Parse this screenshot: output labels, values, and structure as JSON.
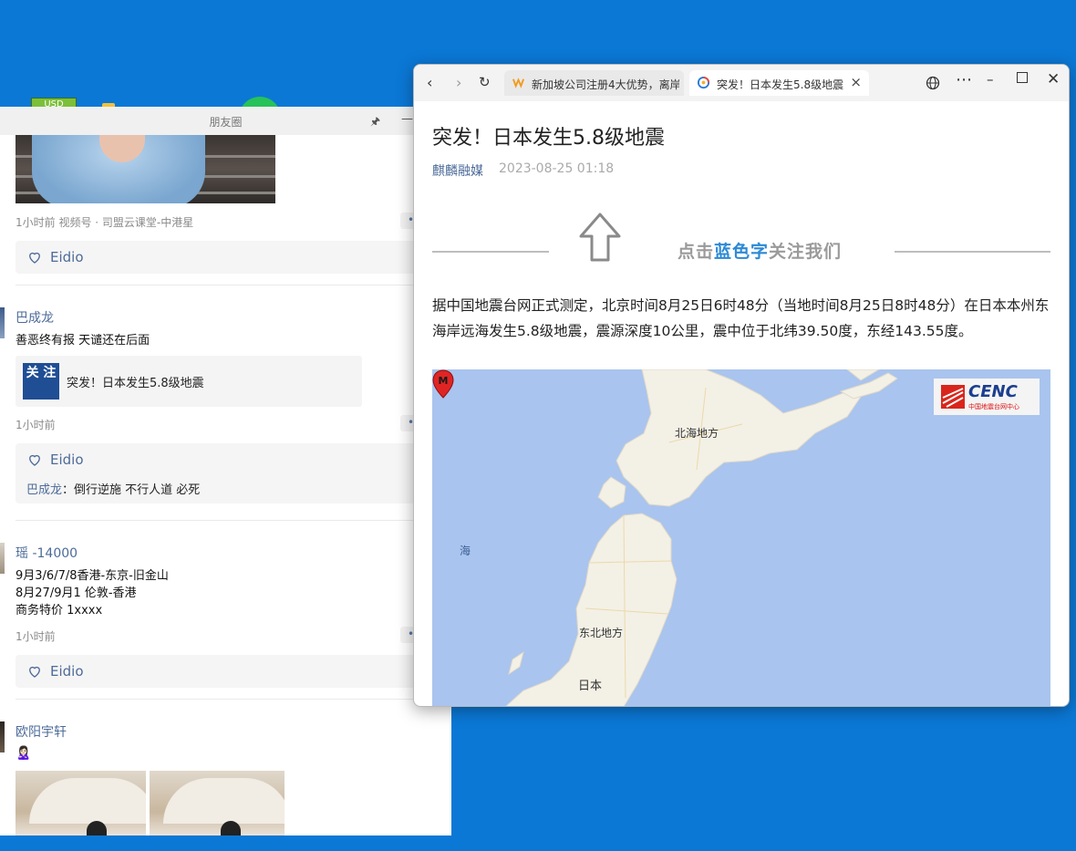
{
  "desktop": {
    "usd_label": "USD"
  },
  "moments": {
    "title": "朋友圈",
    "posts": [
      {
        "meta": "1小时前  视频号 · 司盟云课堂-中港星",
        "likes": "Eidio"
      },
      {
        "author": "巴成龙",
        "text": "善恶终有报   天谴还在后面",
        "link_thumb": "关 注",
        "link_title": "突发！日本发生5.8级地震",
        "meta": "1小时前",
        "likes": "Eidio",
        "comment_author": "巴成龙",
        "comment_text": "：倒行逆施  不行人道  必死"
      },
      {
        "author": "瑶 -14000",
        "lines": [
          "9月3/6/7/8香港-东京-旧金山",
          "8月27/9月1 伦敦-香港",
          "商务特价 1xxxx"
        ],
        "meta": "1小时前",
        "likes": "Eidio"
      },
      {
        "author": "欧阳宇轩",
        "emoji": "🙎🏻‍♀️"
      }
    ]
  },
  "browser": {
    "tabs": [
      {
        "label": "新加坡公司注册4大优势，离岸",
        "active": false
      },
      {
        "label": "突发！日本发生5.8级地震",
        "active": true
      }
    ],
    "close_glyph": "×",
    "icons": [
      "back-icon",
      "forward-icon",
      "refresh-icon",
      "globe-icon",
      "more-icon",
      "minimize-icon",
      "maximize-icon",
      "close-icon"
    ],
    "article": {
      "title": "突发！日本发生5.8级地震",
      "source": "麒麟融媒",
      "date": "2023-08-25 01:18",
      "follow_prefix": "点击",
      "follow_blue": "蓝色字",
      "follow_suffix": "关注我们",
      "body": "据中国地震台网正式测定，北京时间8月25日6时48分（当地时间8月25日8时48分）在日本本州东海岸远海发生5.8级地震，震源深度10公里，震中位于北纬39.50度，东经143.55度。",
      "map": {
        "labels": {
          "hokkaido": "北海地方",
          "tohoku": "东北地方",
          "japan": "日本",
          "sea": "海"
        },
        "logo_text": "CENC",
        "logo_sub": "中国地震台网中心",
        "pin_letter": "M"
      }
    }
  }
}
